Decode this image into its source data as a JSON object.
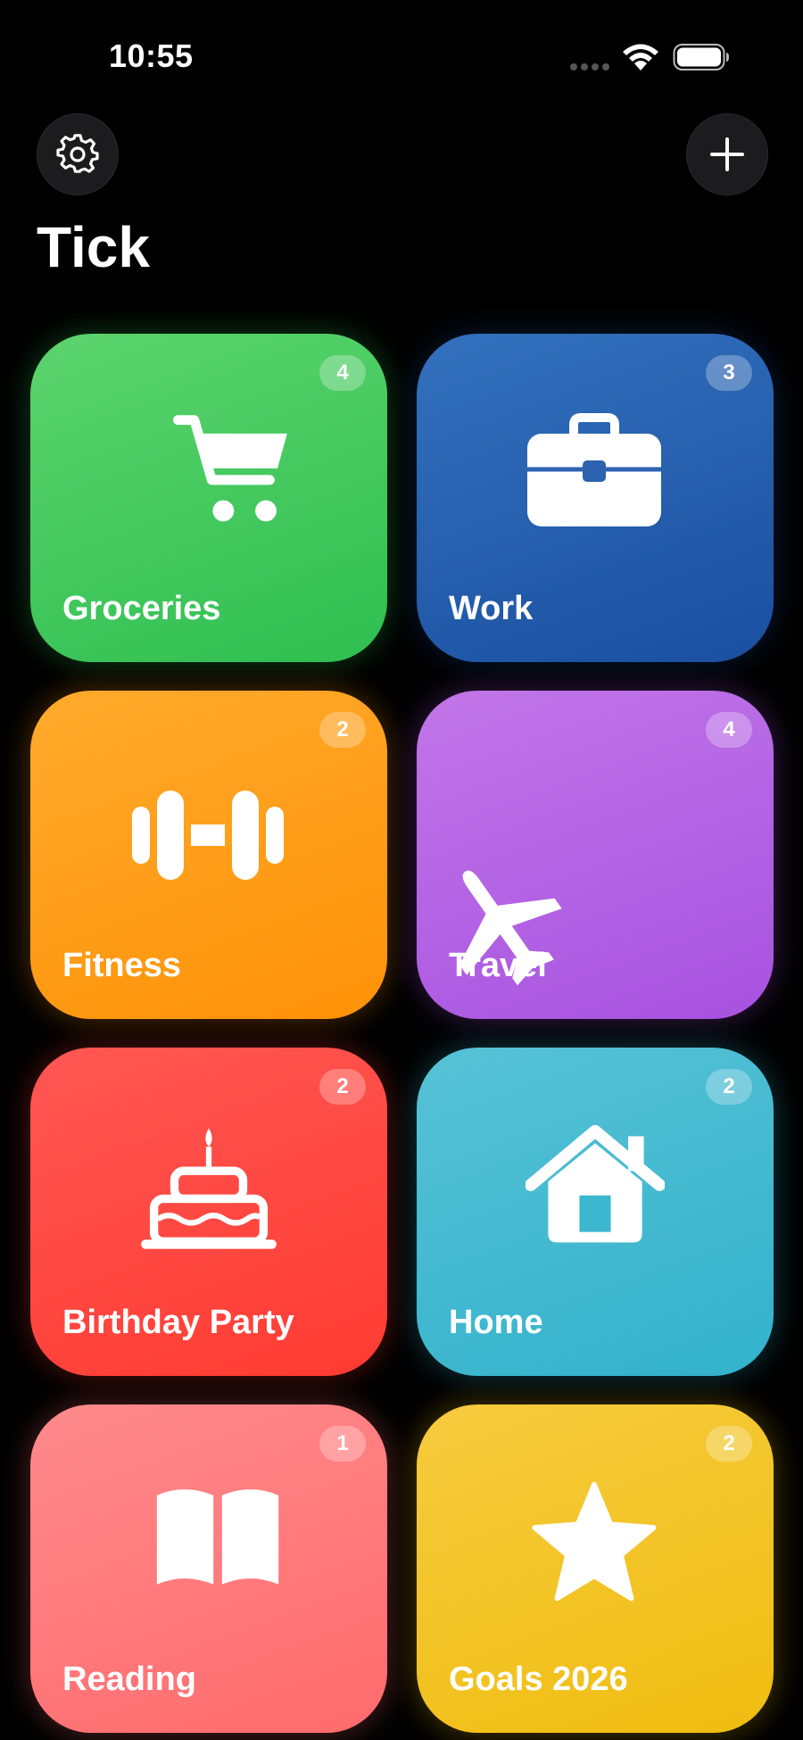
{
  "status_bar": {
    "time": "10:55"
  },
  "header": {
    "settings_icon": "gear-icon",
    "add_icon": "plus-icon",
    "title": "Tick"
  },
  "lists": [
    {
      "label": "Groceries",
      "count": "4",
      "icon": "cart-icon",
      "color_from": "#5cd46e",
      "color_to": "#2fbf51"
    },
    {
      "label": "Work",
      "count": "3",
      "icon": "briefcase-icon",
      "color_from": "#3371bd",
      "color_to": "#1a4fa0"
    },
    {
      "label": "Fitness",
      "count": "2",
      "icon": "dumbbell-icon",
      "color_from": "#ffaa2c",
      "color_to": "#ff9208"
    },
    {
      "label": "Travel",
      "count": "4",
      "icon": "airplane-icon",
      "color_from": "#c176e8",
      "color_to": "#a752e0"
    },
    {
      "label": "Birthday Party",
      "count": "2",
      "icon": "cake-icon",
      "color_from": "#ff5753",
      "color_to": "#ff3b32"
    },
    {
      "label": "Home",
      "count": "2",
      "icon": "house-icon",
      "color_from": "#57c2d6",
      "color_to": "#32b2cb"
    },
    {
      "label": "Reading",
      "count": "1",
      "icon": "book-icon",
      "color_from": "#ff8a8c",
      "color_to": "#ff6b6d"
    },
    {
      "label": "Goals 2026",
      "count": "2",
      "icon": "star-icon",
      "color_from": "#f6cb3e",
      "color_to": "#f0bd10"
    }
  ]
}
